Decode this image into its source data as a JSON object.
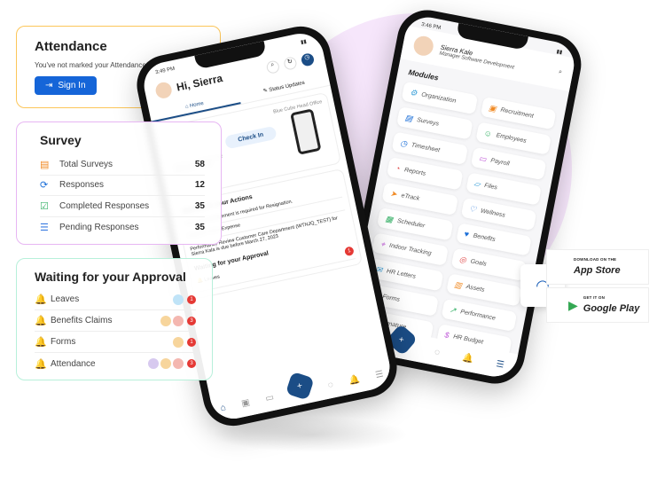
{
  "attendance": {
    "title": "Attendance",
    "message": "You've not marked your Attendance",
    "button": "Sign In",
    "color": "#1565d8"
  },
  "survey": {
    "title": "Survey",
    "items": [
      {
        "label": "Total Surveys",
        "value": "58",
        "icon": "survey-icon"
      },
      {
        "label": "Responses",
        "value": "12",
        "icon": "refresh-icon"
      },
      {
        "label": "Completed Responses",
        "value": "35",
        "icon": "checklist-icon"
      },
      {
        "label": "Pending Responses",
        "value": "35",
        "icon": "list-icon"
      }
    ]
  },
  "approval": {
    "title": "Waiting for your Approval",
    "items": [
      {
        "label": "Leaves",
        "count": "1"
      },
      {
        "label": "Benefits Claims",
        "count": "3"
      },
      {
        "label": "Forms",
        "count": "1"
      },
      {
        "label": "Attendance",
        "count": "3"
      }
    ]
  },
  "phone1": {
    "time": "3:49 PM",
    "greeting": "Hi, Sierra",
    "tabs": [
      "Home",
      "Status Updates"
    ],
    "location": "Blue Cube Head Office",
    "checkin": "Check In",
    "checkin_msg": "You've not marked your Attendance Today!",
    "actions_title": "Waiting for your Actions",
    "actions": [
      "Your acknowledgement is required for Resignation.",
      "Expense Travel Expense",
      "Performance Review Customer Care Department (WTNJQ_TEST) for Sierra Kala is due before March 27, 2023"
    ],
    "approval_title": "Waiting for your Approval",
    "approval_item": "Leaves",
    "approval_count": "1",
    "notif_count": "1"
  },
  "phone2": {
    "time": "3:46 PM",
    "name": "Sierra Kale",
    "role": "Manager Software Development",
    "modules_title": "Modules",
    "modules": [
      "Organization",
      "Recruitment",
      "Surveys",
      "Employees",
      "Timesheet",
      "Payroll",
      "Reports",
      "Files",
      "eTrack",
      "Wellness",
      "Scheduler",
      "Benefits",
      "Indoor Tracking",
      "Goals",
      "HR Letters",
      "Assets",
      "Forms",
      "Performance",
      "Signature",
      "HR Budget"
    ],
    "notif_count": "1"
  },
  "stores": {
    "apple_small": "DOWNLOAD ON THE",
    "apple": "App Store",
    "google_small": "GET IT ON",
    "google": "Google Play"
  }
}
